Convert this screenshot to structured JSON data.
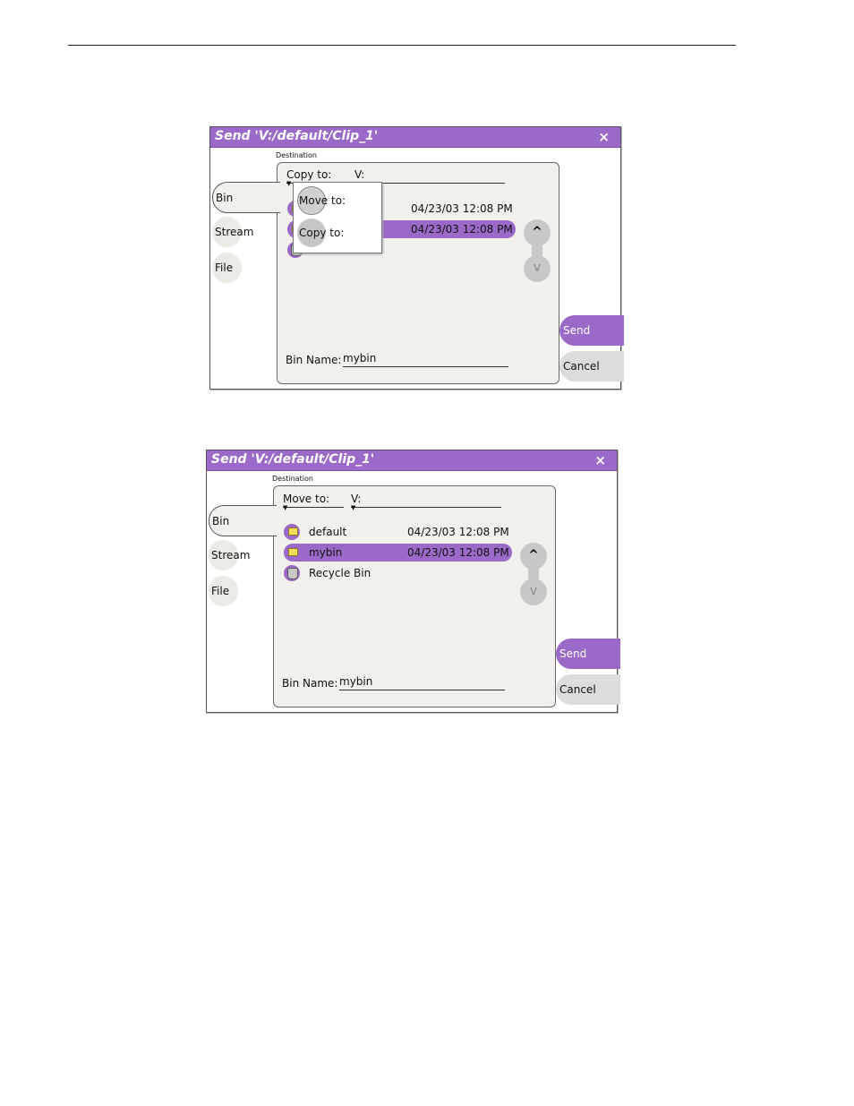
{
  "dialog1": {
    "title": "Send 'V:/default/Clip_1'",
    "close": "×",
    "tabs": [
      "Bin",
      "Stream",
      "File"
    ],
    "destination_label": "Destination",
    "mode_select": "Copy to:",
    "volume_select": "V:",
    "rows": [
      {
        "date": "04/23/03 12:08 PM"
      },
      {
        "date": "04/23/03 12:08 PM"
      }
    ],
    "popup_items": [
      {
        "label_a": "Move",
        "label_b": " to:"
      },
      {
        "label_a": "Copy",
        "label_b": " to:"
      }
    ],
    "bin_name_label": "Bin Name:",
    "bin_name_value": "mybin",
    "send": "Send",
    "cancel": "Cancel",
    "scroll_up": "^",
    "scroll_down": "v"
  },
  "dialog2": {
    "title": "Send 'V:/default/Clip_1'",
    "close": "×",
    "tabs": [
      "Bin",
      "Stream",
      "File"
    ],
    "destination_label": "Destination",
    "mode_select": "Move to:",
    "volume_select": "V:",
    "rows": [
      {
        "name": "default",
        "date": "04/23/03 12:08 PM",
        "icon": "folder-icon"
      },
      {
        "name": "mybin",
        "date": "04/23/03 12:08 PM",
        "icon": "folder-icon"
      },
      {
        "name": "Recycle Bin",
        "date": "",
        "icon": "recycle-bin-icon"
      }
    ],
    "bin_name_label": "Bin Name:",
    "bin_name_value": "mybin",
    "send": "Send",
    "cancel": "Cancel",
    "scroll_up": "^",
    "scroll_down": "v"
  },
  "colors": {
    "accent": "#9b6ac9",
    "panel": "#f1f0ec",
    "button_gray": "#dcdcdc"
  }
}
